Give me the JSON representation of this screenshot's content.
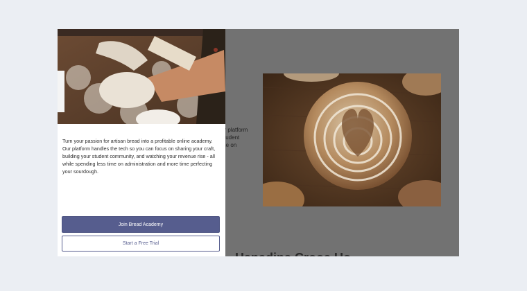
{
  "background_page": {
    "partial_text_lines": [
      "ur platform",
      "student",
      "me on"
    ],
    "partial_heading": "Hanadina Crooa Uo"
  },
  "modal": {
    "hero_image": "hands-kneading-dough-photo",
    "description": "Turn your passion for artisan bread into a profitable online academy. Our platform handles the tech so you can focus on sharing your craft, building your student community, and watching your revenue rise - all while spending less time on administration and more time perfecting your sourdough.",
    "primary_button": "Join Bread Academy",
    "secondary_button": "Start a Free Trial"
  },
  "colors": {
    "accent": "#565d8e",
    "overlay": "#666666",
    "page_background": "#ebeef3"
  }
}
